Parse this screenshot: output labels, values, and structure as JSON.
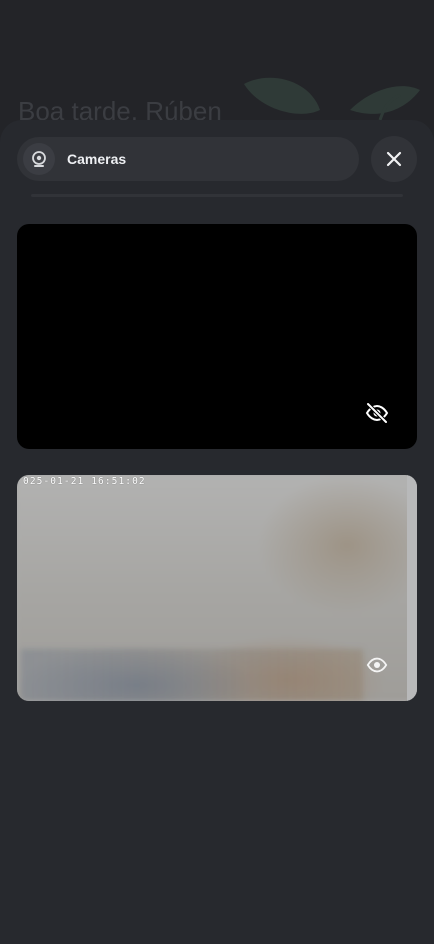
{
  "background": {
    "greeting": "Boa tarde, Rúben"
  },
  "sheet": {
    "title": "Cameras",
    "title_icon": "camera-icon",
    "close_icon": "close-icon"
  },
  "cameras": [
    {
      "status": "hidden",
      "toggle_icon": "eye-off-icon"
    },
    {
      "status": "visible",
      "timestamp": "025-01-21 16:51:02",
      "toggle_icon": "eye-icon"
    }
  ],
  "colors": {
    "background": "#232428",
    "sheet": "#27292e",
    "pill": "#313338",
    "text": "#eef0f3"
  }
}
